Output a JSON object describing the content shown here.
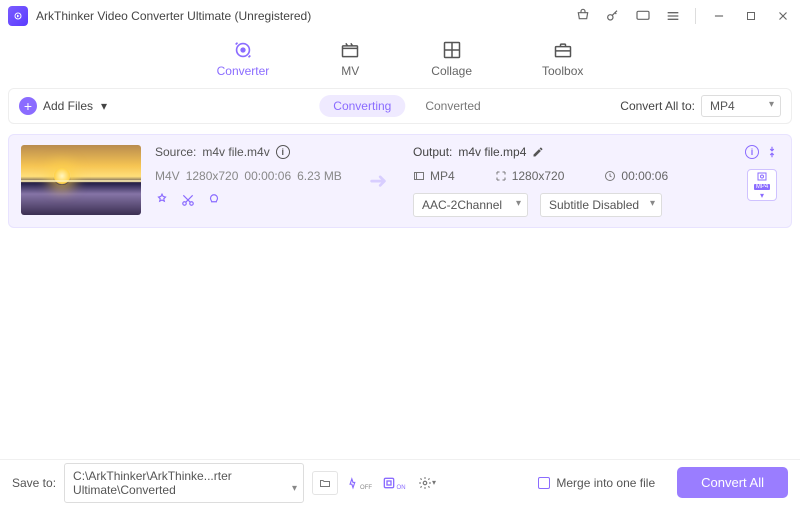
{
  "titlebar": {
    "title": "ArkThinker Video Converter Ultimate (Unregistered)"
  },
  "tabs": {
    "converter": "Converter",
    "mv": "MV",
    "collage": "Collage",
    "toolbox": "Toolbox"
  },
  "toolbar": {
    "add_files": "Add Files",
    "converting": "Converting",
    "converted": "Converted",
    "convert_all_to": "Convert All to:",
    "convert_all_format": "MP4"
  },
  "item": {
    "source_label": "Source:",
    "source_name": "m4v file.m4v",
    "src_format": "M4V",
    "src_res": "1280x720",
    "src_dur": "00:00:06",
    "src_size": "6.23 MB",
    "output_label": "Output:",
    "output_name": "m4v file.mp4",
    "out_format": "MP4",
    "out_res": "1280x720",
    "out_dur": "00:00:06",
    "audio_sel": "AAC-2Channel",
    "subtitle_sel": "Subtitle Disabled",
    "fmt_badge": "MP4"
  },
  "bottom": {
    "save_to": "Save to:",
    "path": "C:\\ArkThinker\\ArkThinke...rter Ultimate\\Converted",
    "merge": "Merge into one file",
    "convert_all": "Convert All"
  }
}
